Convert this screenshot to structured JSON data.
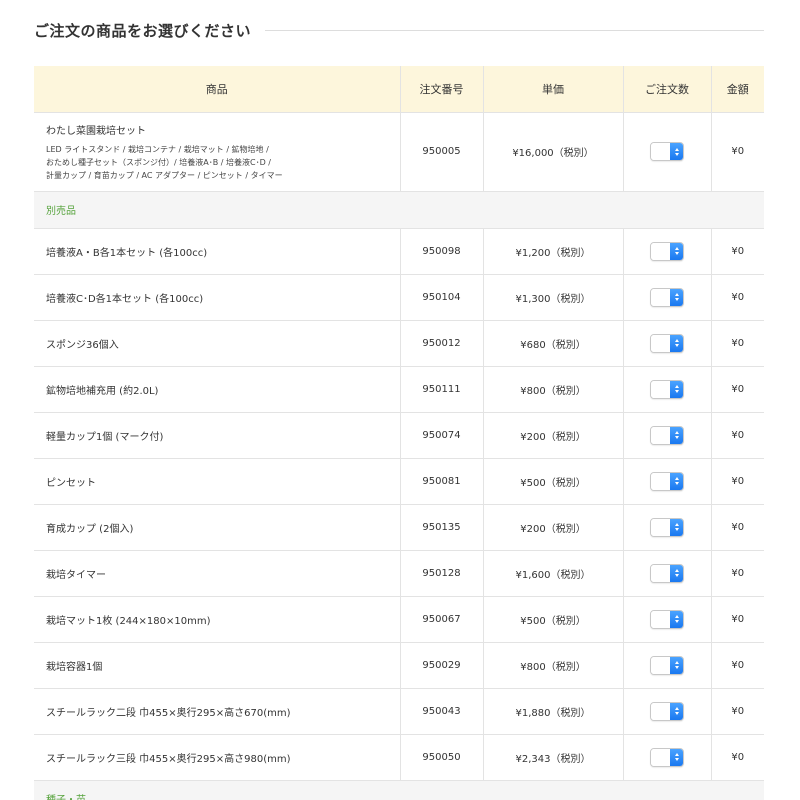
{
  "heading": "ご注文の商品をお選びください",
  "columns": {
    "product": "商品",
    "order_no": "注文番号",
    "unit_price": "単価",
    "quantity": "ご注文数",
    "amount": "金額"
  },
  "main_item": {
    "name": "わたし菜園栽培セット",
    "desc_lines": [
      "LED ライトスタンド / 栽培コンテナ / 栽培マット / 鉱物培地 /",
      "おためし種子セット（スポンジ付）/ 培養液A･B / 培養液C･D /",
      "計量カップ / 育苗カップ / AC アダプター / ピンセット / タイマー"
    ],
    "order_no": "950005",
    "price": "¥16,000（税別）",
    "amount": "¥0"
  },
  "sections": [
    {
      "label": "別売品",
      "items": [
        {
          "name": "培養液A・B各1本セット (各100cc)",
          "order_no": "950098",
          "price": "¥1,200（税別）",
          "amount": "¥0"
        },
        {
          "name": "培養液C･D各1本セット (各100cc)",
          "order_no": "950104",
          "price": "¥1,300（税別）",
          "amount": "¥0"
        },
        {
          "name": "スポンジ36個入",
          "order_no": "950012",
          "price": "¥680（税別）",
          "amount": "¥0"
        },
        {
          "name": "鉱物培地補充用 (約2.0L)",
          "order_no": "950111",
          "price": "¥800（税別）",
          "amount": "¥0"
        },
        {
          "name": "軽量カップ1個 (マーク付)",
          "order_no": "950074",
          "price": "¥200（税別）",
          "amount": "¥0"
        },
        {
          "name": "ピンセット",
          "order_no": "950081",
          "price": "¥500（税別）",
          "amount": "¥0"
        },
        {
          "name": "育成カップ (2個入)",
          "order_no": "950135",
          "price": "¥200（税別）",
          "amount": "¥0"
        },
        {
          "name": "栽培タイマー",
          "order_no": "950128",
          "price": "¥1,600（税別）",
          "amount": "¥0"
        },
        {
          "name": "栽培マット1枚 (244×180×10mm)",
          "order_no": "950067",
          "price": "¥500（税別）",
          "amount": "¥0"
        },
        {
          "name": "栽培容器1個",
          "order_no": "950029",
          "price": "¥800（税別）",
          "amount": "¥0"
        },
        {
          "name": "スチールラック二段 巾455×奥行295×高さ670(mm)",
          "order_no": "950043",
          "price": "¥1,880（税別）",
          "amount": "¥0"
        },
        {
          "name": "スチールラック三段 巾455×奥行295×高さ980(mm)",
          "order_no": "950050",
          "price": "¥2,343（税別）",
          "amount": "¥0"
        }
      ]
    },
    {
      "label": "種子・苗",
      "items": []
    }
  ],
  "colors": {
    "header_bg": "#fdf6dc",
    "section_bg": "#f5f5f5",
    "section_text": "#55a23b",
    "stepper_accent": "#1a78f0"
  }
}
